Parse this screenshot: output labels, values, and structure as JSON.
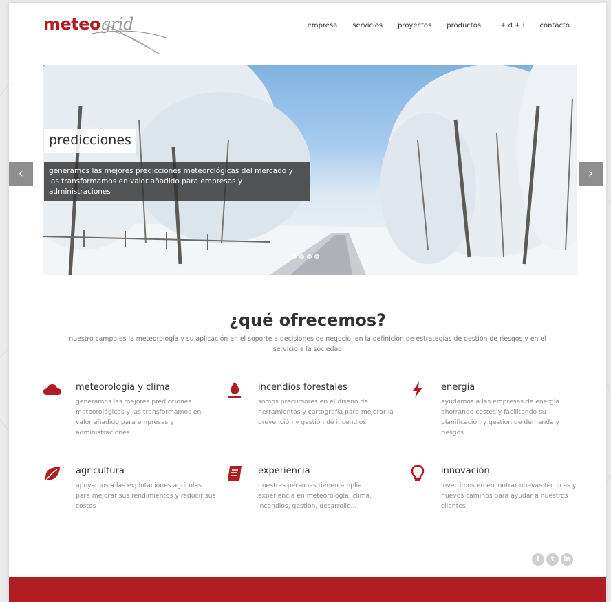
{
  "brand": {
    "logo_part1": "meteo",
    "logo_part2": "grid",
    "accent": "#b01e23"
  },
  "nav": {
    "items": [
      "empresa",
      "servicios",
      "proyectos",
      "productos",
      "i + d + i",
      "contacto"
    ]
  },
  "hero": {
    "title": "predicciones",
    "caption": "generamos las mejores predicciones meteorológicas del mercado y las transformamos en valor añadido para empresas y administraciones",
    "prev_icon": "chevron-left-icon",
    "next_icon": "chevron-right-icon",
    "slides": 4,
    "active_slide": 1
  },
  "offer": {
    "title": "¿qué ofrecemos?",
    "subtitle": "nuestro campo es la meteorología y su aplicación en el soporte a decisiones de negocio, en la definición de estrategias de gestión de riesgos y en el servicio a la sociedad",
    "features": [
      {
        "icon": "cloud-icon",
        "title": "meteorología y clima",
        "text": "generamos las mejores predicciones meteorológicas y las transformamos en valor añadido para empresas y administraciones"
      },
      {
        "icon": "fire-icon",
        "title": "incendios forestales",
        "text": "somos precursores en el diseño de herramientas y cartografía para mejorar la prevención y gestión de incendios"
      },
      {
        "icon": "bolt-icon",
        "title": "energía",
        "text": "ayudamos a las empresas de energía ahorrando costes y facilitando su planificación y gestión de demanda y riesgos"
      },
      {
        "icon": "leaf-icon",
        "title": "agricultura",
        "text": "apoyamos a las explotaciones agrícolas para mejorar sus rendimientos y reducir sus costes"
      },
      {
        "icon": "book-icon",
        "title": "experiencia",
        "text": "nuestras personas tienen amplia experiencia en meteorología, clima, incendios, gestión, desarrollo..."
      },
      {
        "icon": "lightbulb-icon",
        "title": "innovación",
        "text": "invertimos en encontrar nuevas técnicas y nuevos caminos para ayudar a nuestros clientes"
      }
    ]
  },
  "social": {
    "items": [
      "f",
      "t",
      "in"
    ]
  }
}
